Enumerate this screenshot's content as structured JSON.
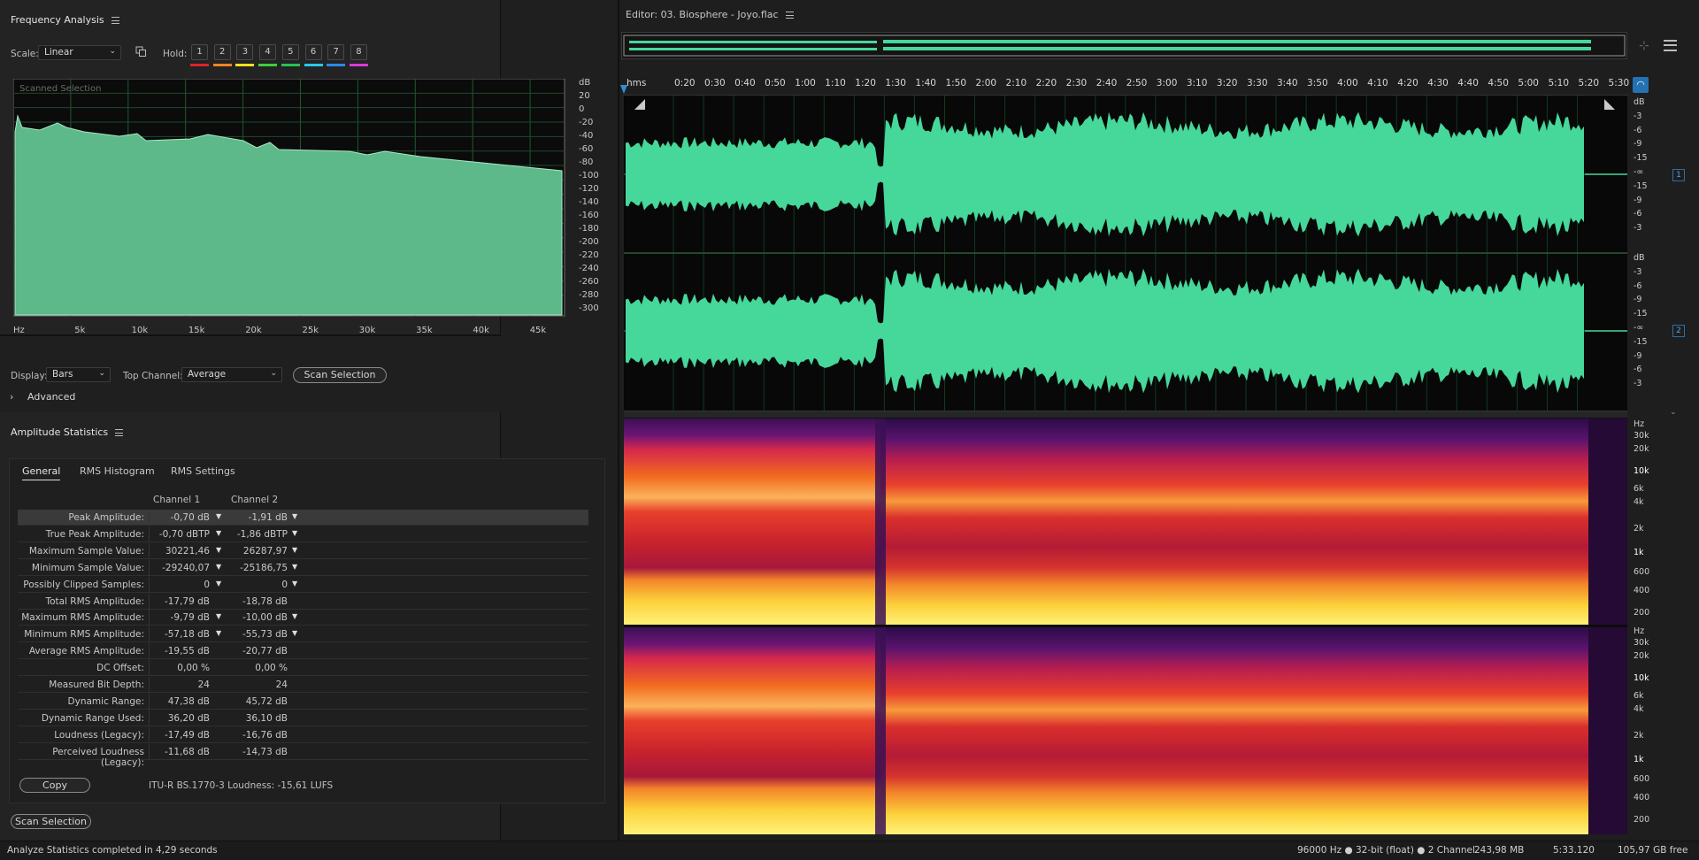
{
  "freq": {
    "title": "Frequency Analysis",
    "scale_label": "Scale:",
    "scale_value": "Linear",
    "hold_label": "Hold:",
    "hold_buttons": [
      "1",
      "2",
      "3",
      "4",
      "5",
      "6",
      "7",
      "8"
    ],
    "hold_colors": [
      "#e0242a",
      "#ef8422",
      "#f3df1e",
      "#3fcf3c",
      "#29c24f",
      "#28c7ec",
      "#2a8ae8",
      "#d63ad6"
    ],
    "graph_label": "Scanned Selection",
    "db_ticks": [
      "dB",
      "20",
      "0",
      "-20",
      "-40",
      "-60",
      "-80",
      "-100",
      "-120",
      "-140",
      "-160",
      "-180",
      "-200",
      "-220",
      "-240",
      "-260",
      "-280",
      "-300"
    ],
    "hz_ticks": [
      "Hz",
      "5k",
      "10k",
      "15k",
      "20k",
      "25k",
      "30k",
      "35k",
      "40k",
      "45k"
    ],
    "display_label": "Display:",
    "display_value": "Bars",
    "top_channel_label": "Top Channel:",
    "top_channel_value": "Average",
    "scan_button": "Scan Selection",
    "advanced_label": "Advanced",
    "fill_color": "#5db88a"
  },
  "amp": {
    "title": "Amplitude Statistics",
    "tabs": [
      "General",
      "RMS Histogram",
      "RMS Settings"
    ],
    "active_tab": "General",
    "col_headers": [
      "Channel 1",
      "Channel 2"
    ],
    "rows": [
      {
        "label": "Peak Amplitude:",
        "c1": "-0,70 dB",
        "c2": "-1,91 dB",
        "flag": true
      },
      {
        "label": "True Peak Amplitude:",
        "c1": "-0,70 dBTP",
        "c2": "-1,86 dBTP",
        "flag": true
      },
      {
        "label": "Maximum Sample Value:",
        "c1": "30221,46",
        "c2": "26287,97",
        "flag": true
      },
      {
        "label": "Minimum Sample Value:",
        "c1": "-29240,07",
        "c2": "-25186,75",
        "flag": true
      },
      {
        "label": "Possibly Clipped Samples:",
        "c1": "0",
        "c2": "0",
        "flag": true
      },
      {
        "label": "Total RMS Amplitude:",
        "c1": "-17,79 dB",
        "c2": "-18,78 dB",
        "flag": false
      },
      {
        "label": "Maximum RMS Amplitude:",
        "c1": "-9,79 dB",
        "c2": "-10,00 dB",
        "flag": true
      },
      {
        "label": "Minimum RMS Amplitude:",
        "c1": "-57,18 dB",
        "c2": "-55,73 dB",
        "flag": true
      },
      {
        "label": "Average RMS Amplitude:",
        "c1": "-19,55 dB",
        "c2": "-20,77 dB",
        "flag": false
      },
      {
        "label": "DC Offset:",
        "c1": "0,00 %",
        "c2": "0,00 %",
        "flag": false
      },
      {
        "label": "Measured Bit Depth:",
        "c1": "24",
        "c2": "24",
        "flag": false
      },
      {
        "label": "Dynamic Range:",
        "c1": "47,38 dB",
        "c2": "45,72 dB",
        "flag": false
      },
      {
        "label": "Dynamic Range Used:",
        "c1": "36,20 dB",
        "c2": "36,10 dB",
        "flag": false
      },
      {
        "label": "Loudness (Legacy):",
        "c1": "-17,49 dB",
        "c2": "-16,76 dB",
        "flag": false
      },
      {
        "label": "Perceived Loudness (Legacy):",
        "c1": "-11,68 dB",
        "c2": "-14,73 dB",
        "flag": false
      }
    ],
    "copy_button": "Copy",
    "lufs_text": "ITU-R BS.1770-3 Loudness: -15,61 LUFS",
    "scan_button": "Scan Selection"
  },
  "editor": {
    "title": "Editor: 03. Biosphere - Joyo.flac",
    "ruler": [
      "hms",
      "0:20",
      "0:30",
      "0:40",
      "0:50",
      "1:00",
      "1:10",
      "1:20",
      "1:30",
      "1:40",
      "1:50",
      "2:00",
      "2:10",
      "2:20",
      "2:30",
      "2:40",
      "2:50",
      "3:00",
      "3:10",
      "3:20",
      "3:30",
      "3:40",
      "3:50",
      "4:00",
      "4:10",
      "4:20",
      "4:30",
      "4:40",
      "4:50",
      "5:00",
      "5:10",
      "5:20",
      "5:30"
    ],
    "db_scale": [
      "dB",
      "-3",
      "-6",
      "-9",
      "-15",
      "-∞",
      "-15",
      "-9",
      "-6",
      "-3"
    ],
    "channel_badges": [
      "1",
      "2"
    ],
    "hz_scale": [
      "Hz",
      "30k",
      "20k",
      "10k",
      "6k",
      "4k",
      "2k",
      "1k",
      "600",
      "400",
      "200"
    ],
    "wave_color": "#46d79a"
  },
  "status": {
    "left": "Analyze Statistics completed in 4,29 seconds",
    "format": "96000 Hz ● 32-bit (float) ● 2 Channel",
    "size": "243,98 MB",
    "duration": "5:33.120",
    "free": "105,97 GB free"
  }
}
